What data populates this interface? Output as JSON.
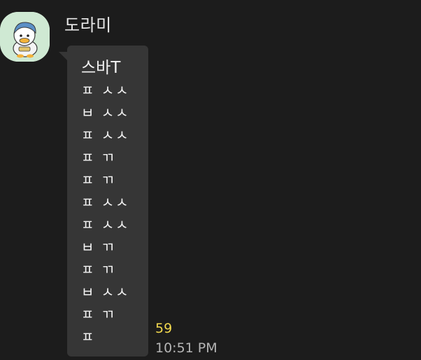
{
  "message": {
    "sender_name": "도라미",
    "avatar_icon": "duck-character-avatar",
    "lines": [
      "스바T",
      "ㅍ ㅅㅅ",
      "ㅂ ㅅㅅ",
      "ㅍ ㅅㅅ",
      "ㅍ ㄲ",
      "ㅍ ㄲ",
      "ㅍ ㅅㅅ",
      "ㅍ ㅅㅅ",
      "ㅂ ㄲ",
      "ㅍ ㄲ",
      "ㅂ ㅅㅅ",
      "ㅍ ㄲ",
      "ㅍ"
    ],
    "unread_count": "59",
    "time": "10:51 PM"
  },
  "colors": {
    "background": "#1c1c1c",
    "bubble": "#363636",
    "unread": "#f2d94e",
    "time": "#b5b5b5"
  }
}
